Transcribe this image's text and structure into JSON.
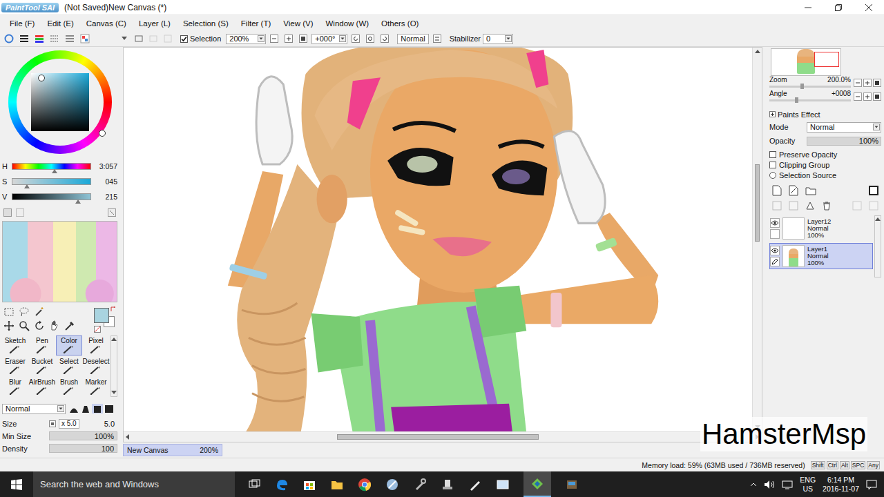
{
  "window": {
    "app_name": "PaintTool SAI",
    "title": "(Not Saved)New Canvas (*)"
  },
  "menu": [
    "File (F)",
    "Edit (E)",
    "Canvas (C)",
    "Layer (L)",
    "Selection (S)",
    "Filter (T)",
    "View (V)",
    "Window (W)",
    "Others (O)"
  ],
  "toolbar": {
    "selection": {
      "label": "Selection",
      "checked": true
    },
    "zoom": "200%",
    "rotation": "+000°",
    "blend_mode": "Normal",
    "stabilizer": {
      "label": "Stabilizer",
      "value": "0"
    }
  },
  "color_sliders": [
    {
      "label": "H",
      "reading": "3:057",
      "level": 0.54
    },
    {
      "label": "S",
      "reading": "045",
      "level": 0.19
    },
    {
      "label": "V",
      "reading": "215",
      "level": 0.84
    }
  ],
  "tools": [
    {
      "label": "Sketch",
      "selected": false
    },
    {
      "label": "Pen",
      "selected": false
    },
    {
      "label": "Color",
      "selected": true
    },
    {
      "label": "Pixel",
      "selected": false
    },
    {
      "label": "Eraser",
      "selected": false
    },
    {
      "label": "Bucket",
      "selected": false
    },
    {
      "label": "Select",
      "selected": false
    },
    {
      "label": "Deselect",
      "selected": false
    },
    {
      "label": "Blur",
      "selected": false
    },
    {
      "label": "AirBrush",
      "selected": false
    },
    {
      "label": "Brush",
      "selected": false
    },
    {
      "label": "Marker",
      "selected": false
    }
  ],
  "brush": {
    "mode": "Normal",
    "size": {
      "label": "Size",
      "field": "x 5.0",
      "value": "5.0"
    },
    "settings": [
      {
        "label": "Min Size",
        "value": "100%",
        "level": 1
      },
      {
        "label": "Density",
        "value": "100",
        "level": 1
      }
    ]
  },
  "navigator": {
    "rows": [
      {
        "label": "Zoom",
        "value": "200.0%",
        "level": 0.4
      },
      {
        "label": "Angle",
        "value": "+0008",
        "level": 0.33
      }
    ]
  },
  "paints_effect": {
    "title": "Paints Effect",
    "mode": {
      "label": "Mode",
      "value": "Normal"
    },
    "opacity": {
      "label": "Opacity",
      "value": "100%",
      "level": 1
    },
    "options": [
      {
        "label": "Preserve Opacity",
        "checked": false,
        "kind": "checkbox"
      },
      {
        "label": "Clipping Group",
        "checked": false,
        "kind": "checkbox"
      },
      {
        "label": "Selection Source",
        "checked": false,
        "kind": "radio"
      }
    ]
  },
  "layers": [
    {
      "name": "Layer12",
      "mode": "Normal",
      "opacity": "100%",
      "visible": true,
      "selected": false,
      "kind": "blank"
    },
    {
      "name": "Layer1",
      "mode": "Normal",
      "opacity": "100%",
      "visible": true,
      "selected": true,
      "kind": "art"
    }
  ],
  "document_tabs": [
    {
      "label": "New Canvas",
      "zoom": "200%",
      "selected": true
    }
  ],
  "status_bar": {
    "memory": "Memory load: 59% (63MB used / 736MB reserved)",
    "keys": [
      "Shift",
      "Ctrl",
      "Alt",
      "SPC",
      "Any"
    ]
  },
  "watermark": "HamsterMsp",
  "taskbar": {
    "search_placeholder": "Search the web and Windows",
    "language": [
      "ENG",
      "US"
    ],
    "time": "6:14 PM",
    "date": "2016-11-07"
  }
}
